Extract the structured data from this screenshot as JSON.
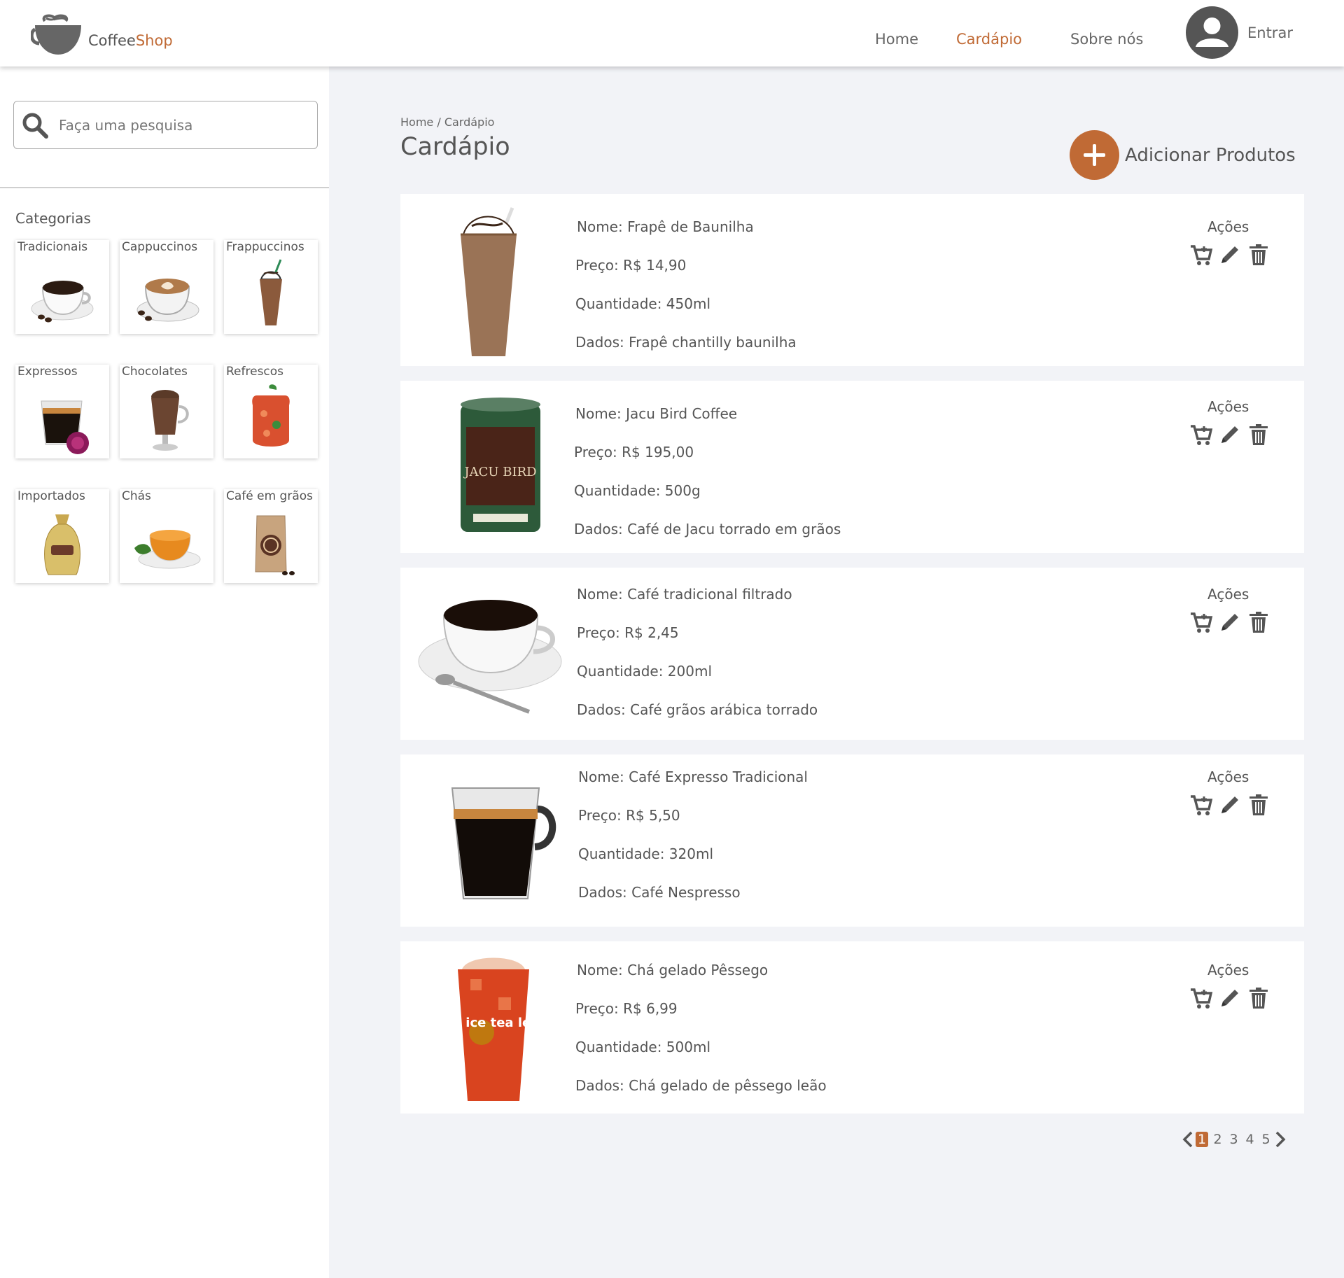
{
  "header": {
    "brand": {
      "part1": "Coffee",
      "part2": "Shop"
    },
    "nav": [
      {
        "label": "Home",
        "active": false
      },
      {
        "label": "Cardápio",
        "active": true
      },
      {
        "label": "Sobre nós",
        "active": false
      }
    ],
    "login_label": "Entrar"
  },
  "sidebar": {
    "search_placeholder": "Faça uma pesquisa",
    "categories_title": "Categorias",
    "categories": [
      {
        "label": "Tradicionais",
        "icon": "coffee-cup-beans-icon"
      },
      {
        "label": "Cappuccinos",
        "icon": "cappuccino-icon"
      },
      {
        "label": "Frappuccinos",
        "icon": "frappuccino-icon"
      },
      {
        "label": "Expressos",
        "icon": "espresso-glass-icon"
      },
      {
        "label": "Chocolates",
        "icon": "hot-chocolate-icon"
      },
      {
        "label": "Refrescos",
        "icon": "refresco-jar-icon"
      },
      {
        "label": "Importados",
        "icon": "coffee-sack-icon"
      },
      {
        "label": "Chás",
        "icon": "tea-cup-icon"
      },
      {
        "label": "Café em grãos",
        "icon": "coffee-bag-icon"
      }
    ]
  },
  "main": {
    "breadcrumb": "Home / Cardápio",
    "title": "Cardápio",
    "add_label": "Adicionar Produtos",
    "actions_label": "Ações",
    "products": [
      {
        "nome": "Nome: Frapê de Baunilha",
        "preco": "Preço: R$ 14,90",
        "quantidade": "Quantidade: 450ml",
        "dados": "Dados: Frapê chantilly baunilha",
        "image": "frappe-image"
      },
      {
        "nome": "Nome: Jacu Bird Coffee",
        "preco": "Preço:  R$ 195,00",
        "quantidade": "Quantidade: 500g",
        "dados": "Dados: Café de Jacu torrado em grãos",
        "image": "coffee-can-image",
        "can_text": "JACU BIRD"
      },
      {
        "nome": "Nome: Café tradicional filtrado",
        "preco": "Preço: R$ 2,45",
        "quantidade": "Quantidade: 200ml",
        "dados": "Dados: Café grãos arábica torrado",
        "image": "coffee-cup-image"
      },
      {
        "nome": "Nome: Café Expresso Tradicional",
        "preco": "Preço: R$ 5,50",
        "quantidade": "Quantidade: 320ml",
        "dados": "Dados: Café Nespresso",
        "image": "espresso-glass-image"
      },
      {
        "nome": "Nome: Chá gelado Pêssego",
        "preco": "Preço: R$ 6,99",
        "quantidade": "Quantidade: 500ml",
        "dados": "Dados: Chá gelado de pêssego leão",
        "image": "iced-tea-image",
        "cup_text": "ice tea leão"
      }
    ]
  },
  "pagination": {
    "pages": [
      "1",
      "2",
      "3",
      "4",
      "5"
    ],
    "current": "1"
  },
  "colors": {
    "accent": "#c06a35",
    "text": "#555555",
    "background": "#f2f3f7"
  }
}
